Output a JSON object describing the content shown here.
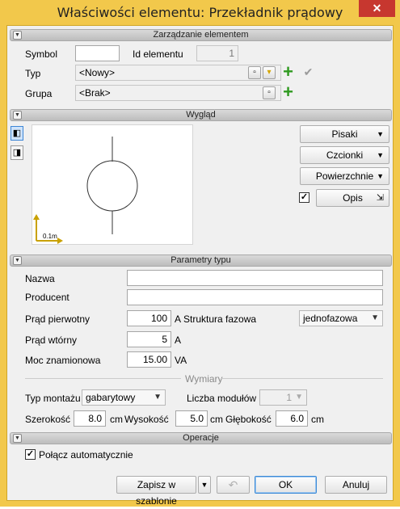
{
  "window": {
    "title": "Właściwości elementu: Przekładnik prądowy",
    "close_label": "✕"
  },
  "sections": {
    "management": "Zarządzanie elementem",
    "appearance": "Wygląd",
    "type_params": "Parametry typu",
    "operations": "Operacje"
  },
  "management": {
    "symbol_label": "Symbol",
    "symbol_value": "",
    "id_label": "Id elementu",
    "id_value": "1",
    "type_label": "Typ",
    "type_value": "<Nowy>",
    "group_label": "Grupa",
    "group_value": "<Brak>"
  },
  "appearance": {
    "scale_label": "0.1m",
    "pens_label": "Pisaki",
    "fonts_label": "Czcionki",
    "surfaces_label": "Powierzchnie",
    "description_label": "Opis",
    "description_checked": true
  },
  "type_params": {
    "name_label": "Nazwa",
    "name_value": "",
    "producer_label": "Producent",
    "producer_value": "",
    "primary_current_label": "Prąd pierwotny",
    "primary_current_value": "100",
    "primary_current_unit": "A",
    "phase_structure_label": "Struktura fazowa",
    "phase_structure_value": "jednofazowa",
    "secondary_current_label": "Prąd wtórny",
    "secondary_current_value": "5",
    "secondary_current_unit": "A",
    "rated_power_label": "Moc znamionowa",
    "rated_power_value": "15.00",
    "rated_power_unit": "VA",
    "dimensions_label": "Wymiary",
    "mount_type_label": "Typ montażu",
    "mount_type_value": "gabarytowy",
    "modules_label": "Liczba modułów",
    "modules_value": "1",
    "width_label": "Szerokość",
    "width_value": "8.0",
    "width_unit": "cm",
    "height_label": "Wysokość",
    "height_value": "5.0",
    "height_unit": "cm",
    "depth_label": "Głębokość",
    "depth_value": "6.0",
    "depth_unit": "cm"
  },
  "operations": {
    "auto_connect_label": "Połącz automatycznie",
    "auto_connect_checked": true
  },
  "footer": {
    "save_template_label": "Zapisz w szablonie",
    "ok_label": "OK",
    "cancel_label": "Anuluj"
  }
}
